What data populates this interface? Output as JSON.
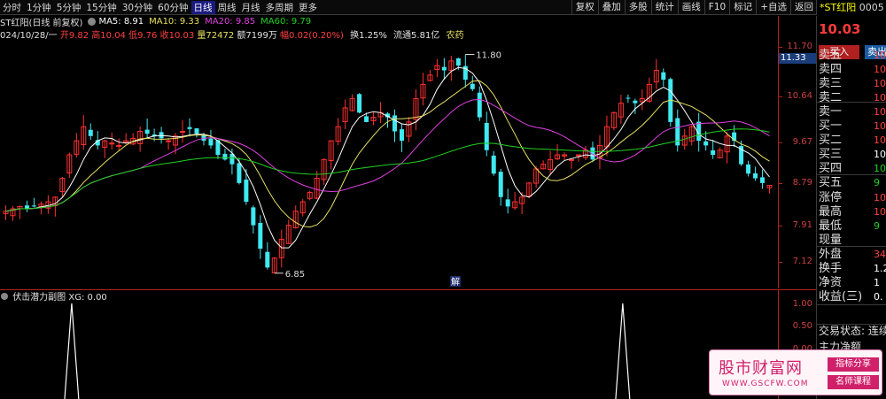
{
  "toolbar": {
    "periods": [
      "分时",
      "1分钟",
      "5分钟",
      "15分钟",
      "30分钟",
      "60分钟",
      "日线",
      "周线",
      "月线",
      "多周期",
      "更多"
    ],
    "active_index": 6,
    "right_buttons": [
      "复权",
      "叠加",
      "多股",
      "统计",
      "画线",
      "F10",
      "标记",
      "+自选",
      "返回"
    ]
  },
  "stock": {
    "name": "*ST红阳",
    "code": "0005"
  },
  "chart_title": "ST红阳(日线 前复权)",
  "ma": [
    {
      "label": "MA5:",
      "value": "8.91",
      "color": "#ffffff"
    },
    {
      "label": "MA10:",
      "value": "9.33",
      "color": "#e8e060"
    },
    {
      "label": "MA20:",
      "value": "9.85",
      "color": "#e040e0"
    },
    {
      "label": "MA60:",
      "value": "9.79",
      "color": "#20d020"
    }
  ],
  "ohlc": {
    "date": "024/10/28/一",
    "open": "开9.82",
    "high": "高10.04",
    "low": "低9.76",
    "close": "收10.03",
    "volume": "量72472",
    "amount": "额7199万",
    "change": "幅0.02(0.20%)",
    "turnover": "换1.25%",
    "float_cap": "流通5.81亿",
    "industry": "农药"
  },
  "price_ticks": [
    "11.70",
    "10.64",
    "9.67",
    "8.79",
    "7.91",
    "7.12"
  ],
  "current_price_box": "11.33",
  "annotations": {
    "high_label": "11.80",
    "low_label": "6.85",
    "jie": "解"
  },
  "sub": {
    "title": "伏击潜力副图",
    "xg": "XG: 0.00",
    "ticks": [
      "1.00",
      "0.50",
      "0.00"
    ]
  },
  "book": {
    "price": "10.03",
    "buy": "买入",
    "sell": "卖出",
    "rows": [
      {
        "label": "卖五",
        "value": "10",
        "color": "r"
      },
      {
        "label": "卖四",
        "value": "10",
        "color": "r"
      },
      {
        "label": "卖三",
        "value": "10",
        "color": "r"
      },
      {
        "label": "卖二",
        "value": "10",
        "color": "r"
      },
      {
        "label": "卖一",
        "value": "10",
        "color": "r"
      },
      {
        "label": "买一",
        "value": "10",
        "color": "r"
      },
      {
        "label": "买二",
        "value": "10",
        "color": "r"
      },
      {
        "label": "买三",
        "value": "10",
        "color": "w"
      },
      {
        "label": "买四",
        "value": "10",
        "color": "g"
      },
      {
        "label": "买五",
        "value": "9",
        "color": "g"
      },
      {
        "label": "涨停",
        "value": "10",
        "color": "r"
      },
      {
        "label": "最高",
        "value": "10",
        "color": "r"
      },
      {
        "label": "最低",
        "value": "9",
        "color": "g"
      },
      {
        "label": "现量",
        "value": "",
        "color": "w"
      },
      {
        "label": "外盘",
        "value": "34",
        "color": "r"
      },
      {
        "label": "换手",
        "value": "1.2",
        "color": "w"
      },
      {
        "label": "净资",
        "value": "1",
        "color": "w"
      },
      {
        "label": "收益(三)",
        "value": "0.",
        "color": "w"
      }
    ],
    "trade_status": "交易状态: 连续",
    "main_net": "主力净额"
  },
  "watermark": {
    "title": "股市财富网",
    "url": "WWW.GSCFW.COM",
    "b1": "指标分享",
    "b2": "名师课程"
  },
  "colors": {
    "up": "#ff3030",
    "down": "#40e8f0",
    "ma5": "#ffffff",
    "ma10": "#e8e060",
    "ma20": "#e040e0",
    "ma60": "#20d020",
    "axis": "#b22222"
  }
}
